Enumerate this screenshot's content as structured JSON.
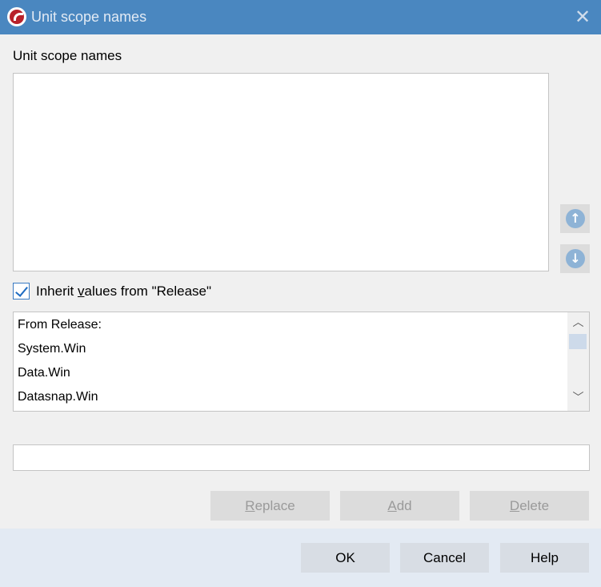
{
  "window": {
    "title": "Unit scope names"
  },
  "section_label": "Unit scope names",
  "scope_list": {
    "items": []
  },
  "inherit": {
    "checked": true,
    "label_pre": "Inherit ",
    "label_accel": "v",
    "label_post": "alues from \"Release\""
  },
  "inherited_list": {
    "items": [
      "From Release:",
      "System.Win",
      "Data.Win",
      "Datasnap.Win"
    ]
  },
  "edit_field": {
    "value": ""
  },
  "actions": {
    "replace": {
      "accel": "R",
      "rest": "eplace"
    },
    "add": {
      "accel": "A",
      "rest": "dd"
    },
    "delete": {
      "accel": "D",
      "rest": "elete"
    }
  },
  "footer": {
    "ok": "OK",
    "cancel": "Cancel",
    "help": "Help"
  },
  "icons": {
    "app": "delphi-logo-icon",
    "close": "close-icon",
    "move_up": "arrow-up-circle-icon",
    "move_down": "arrow-down-circle-icon",
    "scroll_up": "chevron-up-icon",
    "scroll_down": "chevron-down-icon"
  },
  "colors": {
    "titlebar": "#4a87c0",
    "accent": "#1f6cc2"
  }
}
